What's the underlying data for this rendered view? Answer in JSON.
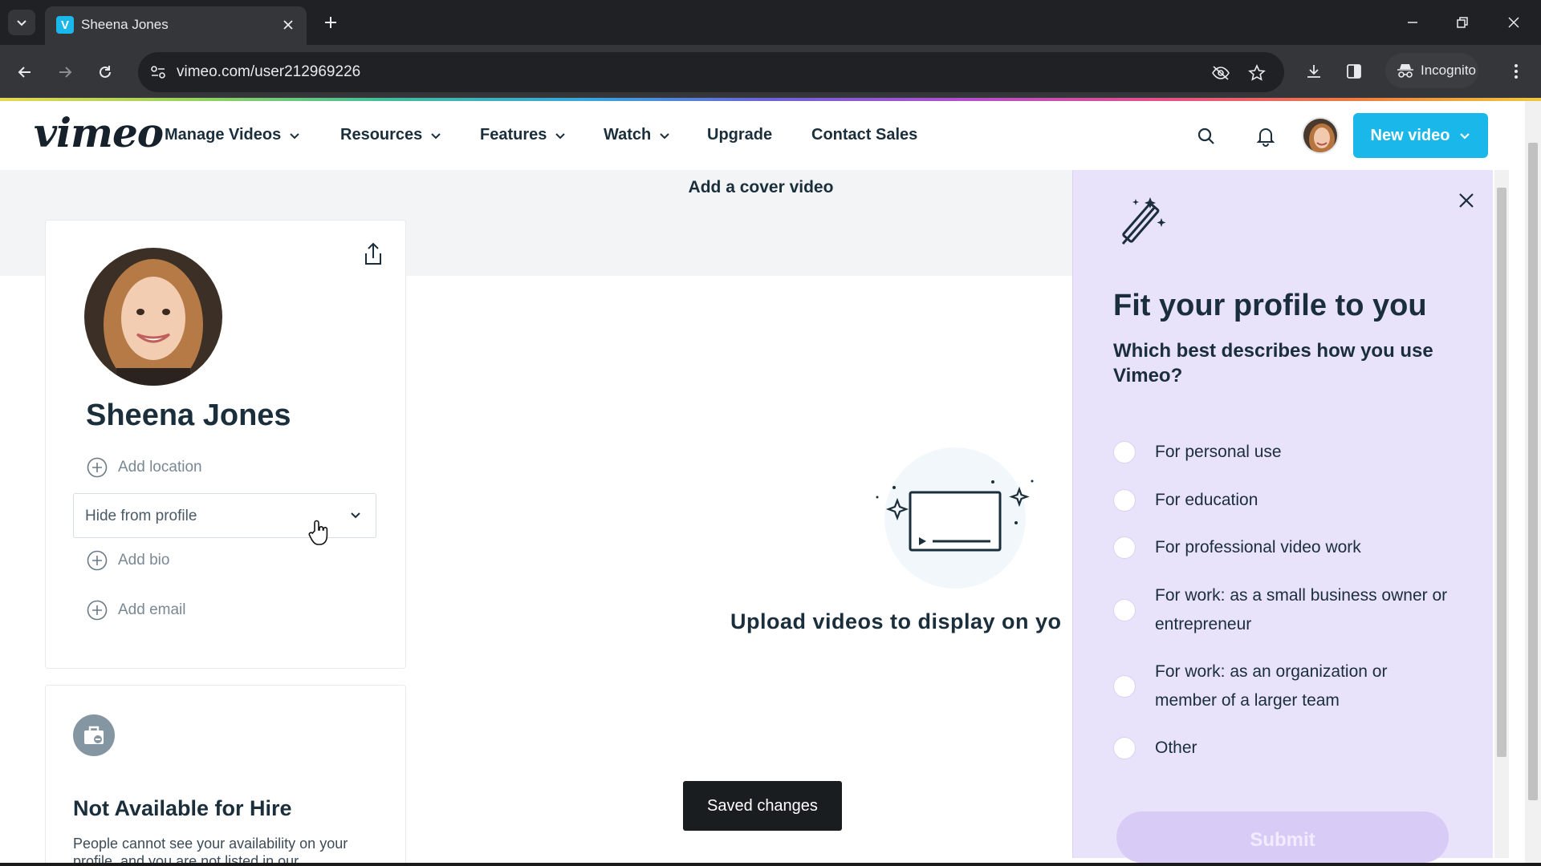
{
  "browser": {
    "tab_title": "Sheena Jones",
    "tab_favicon": "V",
    "url": "vimeo.com/user212969226",
    "incognito_label": "Incognito"
  },
  "header": {
    "logo": "vimeo",
    "nav": [
      {
        "label": "Manage Videos",
        "dropdown": true
      },
      {
        "label": "Resources",
        "dropdown": true
      },
      {
        "label": "Features",
        "dropdown": true
      },
      {
        "label": "Watch",
        "dropdown": true
      },
      {
        "label": "Upgrade",
        "dropdown": false
      },
      {
        "label": "Contact Sales",
        "dropdown": false
      }
    ],
    "new_video_label": "New video",
    "accent": "#1ab7ea"
  },
  "cover": {
    "title": "Add a cover video"
  },
  "profile": {
    "name": "Sheena Jones",
    "add_location": "Add location",
    "visibility_select": "Hide from profile",
    "add_bio": "Add bio",
    "add_email": "Add email"
  },
  "hire": {
    "title": "Not Available for Hire",
    "text": "People cannot see your availability on your profile, and you are not listed in our"
  },
  "main": {
    "upload_text": "Upload videos to display on yo"
  },
  "toast": {
    "text": "Saved changes"
  },
  "panel": {
    "title": "Fit your profile to you",
    "question": "Which best describes how you use Vimeo?",
    "options": [
      "For personal use",
      "For education",
      "For professional video work",
      "For work: as a small business owner or entrepreneur",
      "For work: as an organization or member of a larger team",
      "Other"
    ],
    "submit_label": "Submit",
    "background": "#e9e2fb"
  }
}
